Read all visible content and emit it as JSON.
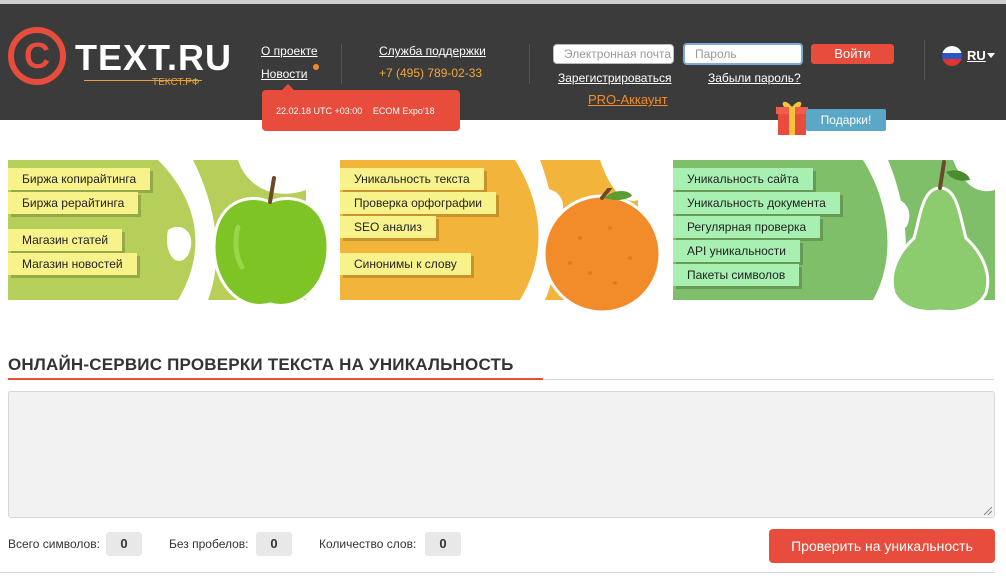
{
  "header": {
    "logo_mark": "C",
    "logo_text": "TEXT.RU",
    "logo_sub": "ТЕКСТ.РФ",
    "nav": {
      "about": "О проекте",
      "news": "Новости",
      "support": "Служба поддержки",
      "phone": "+7 (495) 789-02-33"
    },
    "event": {
      "date": "22.02.18 UTC +03:00",
      "name": "ECOM Expo'18"
    },
    "auth": {
      "email_placeholder": "Электронная почта",
      "password_placeholder": "Пароль",
      "login_button": "Войти",
      "register_link": "Зарегистрироваться",
      "forgot_link": "Забыли пароль?",
      "pro_link": "PRO-Аккаунт"
    },
    "gifts_button": "Подарки!",
    "language": "RU"
  },
  "banners": {
    "left": {
      "tags": [
        "Биржа копирайтинга",
        "Биржа рерайтинга",
        "Магазин статей",
        "Магазин новостей"
      ],
      "fruit": "apple-icon"
    },
    "middle": {
      "tags": [
        "Уникальность текста",
        "Проверка орфографии",
        "SEO анализ",
        "Синонимы к слову"
      ],
      "fruit": "orange-icon"
    },
    "right": {
      "tags": [
        "Уникальность сайта",
        "Уникальность документа",
        "Регулярная проверка",
        "API уникальности",
        "Пакеты символов"
      ],
      "fruit": "pear-icon"
    }
  },
  "main": {
    "title": "ОНЛАЙН-СЕРВИС ПРОВЕРКИ ТЕКСТА НА УНИКАЛЬНОСТЬ",
    "textarea_value": "",
    "stats": {
      "total_label": "Всего символов:",
      "total_value": "0",
      "nospace_label": "Без пробелов:",
      "nospace_value": "0",
      "words_label": "Количество слов:",
      "words_value": "0"
    },
    "check_button": "Проверить на уникальность"
  },
  "colors": {
    "header_bg": "#3b3b3b",
    "accent_red": "#e84c3d",
    "accent_orange": "#f28c2b",
    "banner_green": "#b5cf5a",
    "banner_orange": "#f2b43a",
    "banner_pear": "#7fbf69"
  }
}
